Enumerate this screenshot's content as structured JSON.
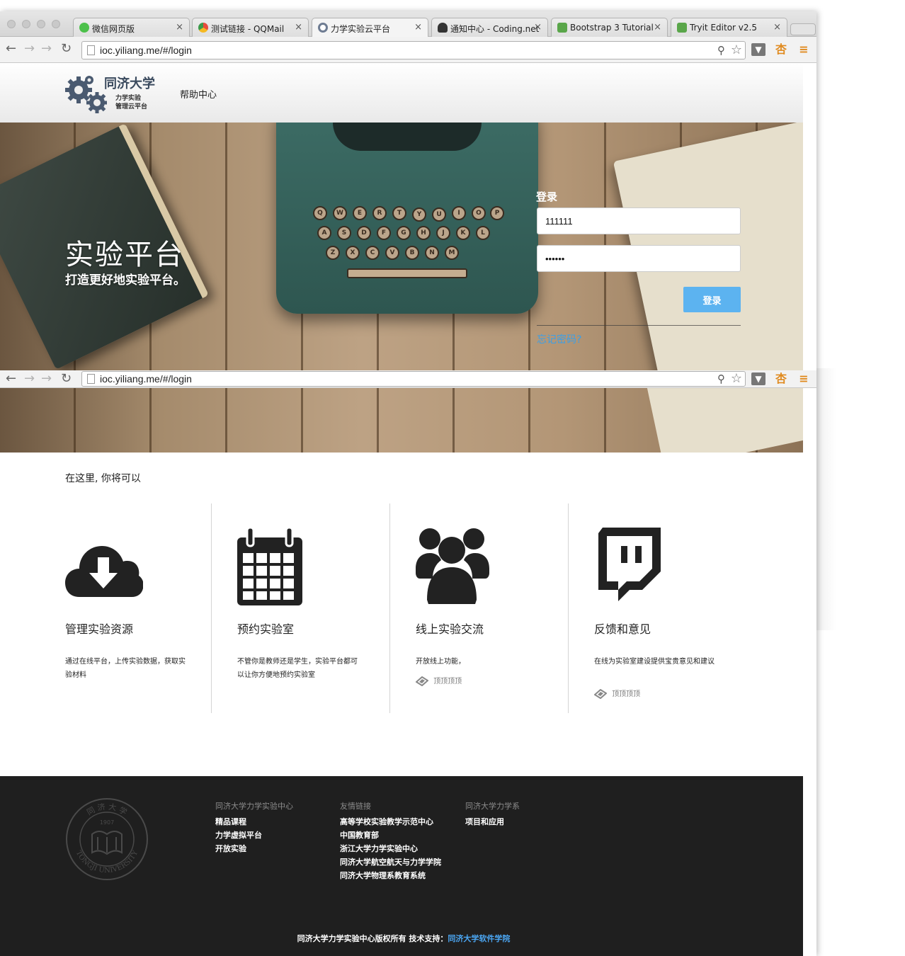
{
  "browser": {
    "tabs": [
      {
        "title": "微信网页版",
        "favicon_color": "#4cc04a",
        "active": false
      },
      {
        "title": "测试链接 - QQMail",
        "favicon_color": "#e8a82c",
        "active": false
      },
      {
        "title": "力学实验云平台",
        "favicon_color": "#6e7c92",
        "active": true
      },
      {
        "title": "通知中心 - Coding.net",
        "favicon_color": "#333333",
        "active": false
      },
      {
        "title": "Bootstrap 3 Tutorial",
        "favicon_color": "#5aa64a",
        "active": false
      },
      {
        "title": "Tryit Editor v2.5",
        "favicon_color": "#5aa64a",
        "active": false
      }
    ],
    "tab_close_glyph": "×",
    "url": "ioc.yiliang.me/#/login",
    "icons": [
      "back-icon",
      "forward-icon",
      "forward-alt-icon",
      "reload-icon",
      "page-icon",
      "zoom-icon",
      "star-icon",
      "mail-extension-icon",
      "xing-extension-icon",
      "menu-icon"
    ]
  },
  "header": {
    "logo_title": "同济大学",
    "logo_line1": "力学实验",
    "logo_line2": "管理云平台",
    "nav_help": "帮助中心"
  },
  "hero": {
    "title": "实验平台",
    "subtitle": "打造更好地实验平台。",
    "login_heading": "登录",
    "username_value": "111111",
    "password_value": "111111",
    "login_button": "登录",
    "forgot_link": "忘记密码?"
  },
  "features": {
    "intro": "在这里, 你将可以",
    "items": [
      {
        "icon": "cloud-download-icon",
        "title": "管理实验资源",
        "desc": "通过在线平台，上传实验数据，获取实验材料",
        "tag": ""
      },
      {
        "icon": "calendar-icon",
        "title": "预约实验室",
        "desc": "不管你是教师还是学生，实验平台都可以让你方便地预约实验室",
        "tag": ""
      },
      {
        "icon": "users-icon",
        "title": "线上实验交流",
        "desc": "开放线上功能，",
        "tag": "顶顶顶顶"
      },
      {
        "icon": "twitch-icon",
        "title": "反馈和意见",
        "desc": "在线为实验室建设提供宝贵意见和建议",
        "tag": "顶顶顶顶"
      }
    ]
  },
  "footer": {
    "seal_text_top": "同 济 大 学",
    "seal_year": "1907",
    "seal_text_bottom": "TONGJI UNIVERSITY",
    "columns": [
      {
        "heading": "同济大学力学实验中心",
        "links": [
          "精品课程",
          "力学虚拟平台",
          "开放实验"
        ]
      },
      {
        "heading": "友情链接",
        "links": [
          "高等学校实验教学示范中心",
          "中国教育部",
          "浙江大学力学实验中心",
          "同济大学航空航天与力学学院",
          "同济大学物理系教育系统"
        ]
      },
      {
        "heading": "同济大学力学系",
        "links": [
          "项目和应用"
        ]
      }
    ],
    "copyright": "同济大学力学实验中心版权所有 技术支持：",
    "copyright_link": "同济大学软件学院"
  },
  "colors": {
    "accent_blue": "#5cb3f0",
    "link_blue": "#3a9fe8",
    "footer_bg": "#1f1f1f"
  }
}
